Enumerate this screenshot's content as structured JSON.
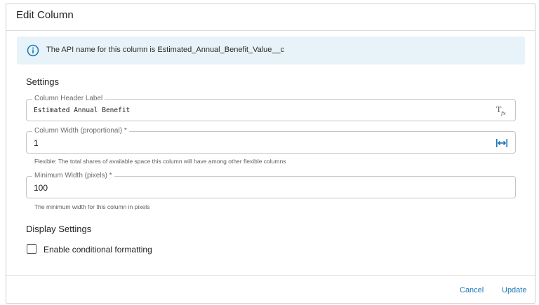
{
  "dialog": {
    "title": "Edit Column"
  },
  "info": {
    "text": "The API name for this column is Estimated_Annual_Benefit_Value__c",
    "icon": "info-icon",
    "color": "#1b78b6"
  },
  "settings": {
    "title": "Settings",
    "header_label": {
      "label": "Column Header Label",
      "value": "Estimated Annual Benefit",
      "icon": "clear-formatting-icon"
    },
    "column_width": {
      "label": "Column Width (proportional) *",
      "value": "1",
      "icon": "resize-horizontal-icon",
      "helper": "Flexible: The total shares of available space this column will have among other flexible columns"
    },
    "min_width": {
      "label": "Minimum Width (pixels) *",
      "value": "100",
      "helper": "The minimum width for this column in pixels"
    }
  },
  "display_settings": {
    "title": "Display Settings",
    "conditional_formatting": {
      "label": "Enable conditional formatting",
      "checked": false
    }
  },
  "footer": {
    "cancel_label": "Cancel",
    "update_label": "Update"
  }
}
